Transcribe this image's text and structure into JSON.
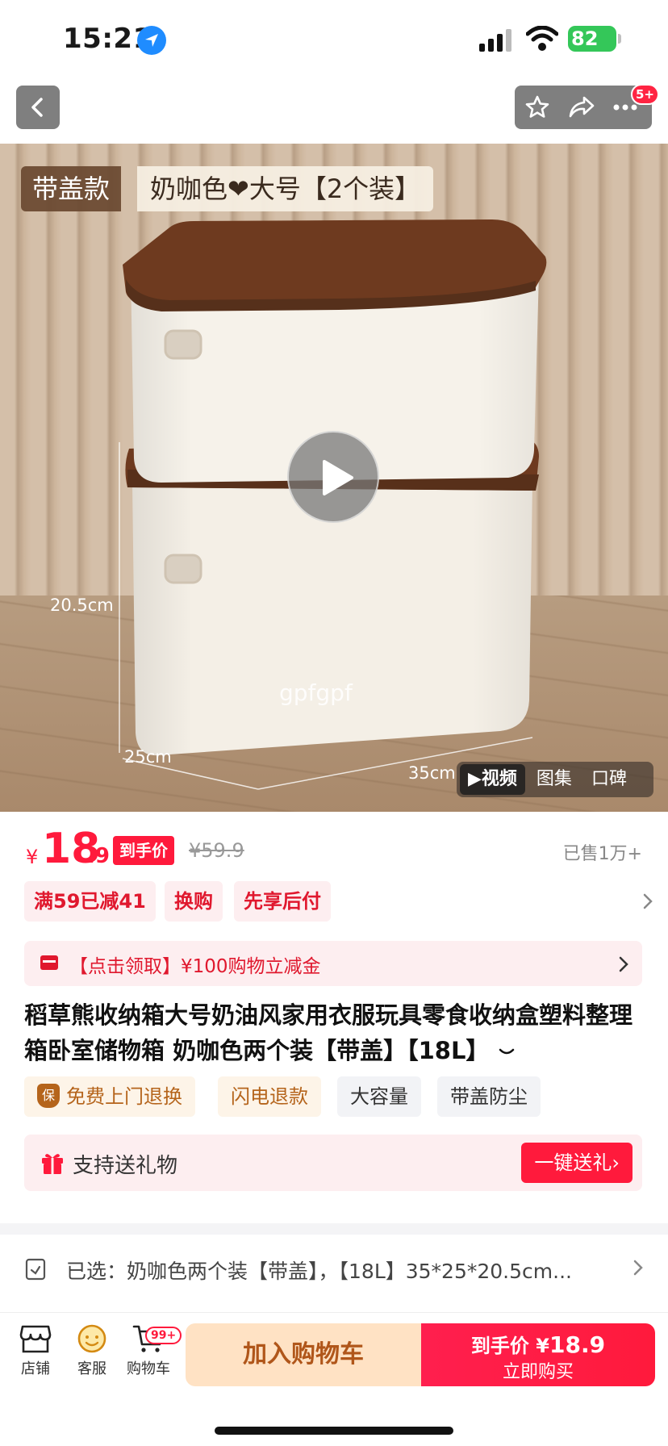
{
  "status_bar": {
    "time": "15:21",
    "battery": "82"
  },
  "nav": {
    "badge": "5+"
  },
  "hero": {
    "tag_label": "带盖款",
    "tag_value": "奶咖色❤大号【2个装】",
    "dim_height": "20.5cm",
    "dim_depth": "25cm",
    "dim_width": "35cm",
    "watermark": "gpfgpf",
    "media_tabs": [
      "▶视频",
      "图集",
      "口碑"
    ]
  },
  "price": {
    "currency": "¥",
    "integer": "18",
    "decimal": ".9",
    "badge": "到手价",
    "original": "¥59.9",
    "sold": "已售1万+"
  },
  "promos": [
    "满59已减41",
    "换购",
    "先享后付"
  ],
  "coupon": {
    "text": "【点击领取】¥100购物立减金"
  },
  "title": "稻草熊收纳箱大号奶油风家用衣服玩具零食收纳盒塑料整理箱卧室储物箱 奶咖色两个装【带盖】【18L】",
  "services": {
    "free_return": "免费上门退换",
    "shield": "保",
    "flash_refund": "闪电退款",
    "capacity": "大容量",
    "dustproof": "带盖防尘"
  },
  "gift": {
    "text": "支持送礼物",
    "button": "一键送礼›"
  },
  "selected": {
    "text": "已选：奶咖色两个装【带盖】，【18L】35*25*20.5cm..."
  },
  "bottom_bar": {
    "store": "店铺",
    "service": "客服",
    "cart": "购物车",
    "cart_badge": "99+",
    "add_to_cart": "加入购物车",
    "buy_label": "到手价",
    "buy_currency": "¥",
    "buy_price": "18.9",
    "buy_now": "立即购买"
  },
  "colors": {
    "accent": "#ff1a3c",
    "coupon_bg": "#fdeef0",
    "add_cart_bg": "#ffe2c4",
    "lid_brown": "#6e3a1f",
    "box_cream": "#f4efe6"
  }
}
